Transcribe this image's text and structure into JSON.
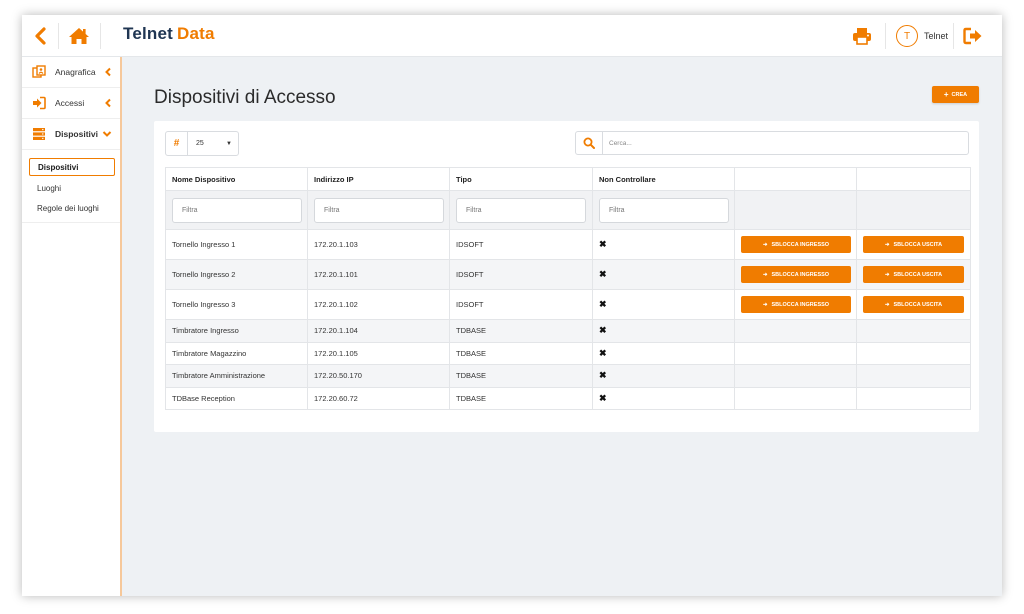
{
  "app": {
    "logo_part1": "Telnet",
    "logo_part2": "Data",
    "brand_color": "#f07c00",
    "logo_color": "#1f3552"
  },
  "topbar": {
    "user_initial": "T",
    "user_name": "Telnet"
  },
  "sidebar": {
    "items": [
      {
        "label": "Anagrafica",
        "icon": "address-card-icon"
      },
      {
        "label": "Accessi",
        "icon": "sign-in-icon"
      },
      {
        "label": "Dispositivi",
        "icon": "server-icon"
      }
    ],
    "subitems": [
      {
        "label": "Dispositivi"
      },
      {
        "label": "Luoghi"
      },
      {
        "label": "Regole dei luoghi"
      }
    ]
  },
  "page": {
    "title": "Dispositivi di Accesso",
    "create_label": "CREA"
  },
  "toolbar": {
    "page_size_symbol": "#",
    "page_size": "25",
    "search_placeholder": "Cerca..."
  },
  "table": {
    "columns": [
      "Nome Dispositivo",
      "Indirizzo IP",
      "Tipo",
      "Non Controllare"
    ],
    "filter_placeholder": "Filtra",
    "unlock_in_label": "SBLOCCA INGRESSO",
    "unlock_out_label": "SBLOCCA USCITA",
    "rows": [
      {
        "name": "Tornello Ingresso 1",
        "ip": "172.20.1.103",
        "type": "IDSOFT",
        "non_controllare": "✖"
      },
      {
        "name": "Tornello Ingresso 2",
        "ip": "172.20.1.101",
        "type": "IDSOFT",
        "non_controllare": "✖"
      },
      {
        "name": "Tornello Ingresso 3",
        "ip": "172.20.1.102",
        "type": "IDSOFT",
        "non_controllare": "✖"
      },
      {
        "name": "Timbratore Ingresso",
        "ip": "172.20.1.104",
        "type": "TDBASE",
        "non_controllare": "✖"
      },
      {
        "name": "Timbratore Magazzino",
        "ip": "172.20.1.105",
        "type": "TDBASE",
        "non_controllare": "✖"
      },
      {
        "name": "Timbratore Amministrazione",
        "ip": "172.20.50.170",
        "type": "TDBASE",
        "non_controllare": "✖"
      },
      {
        "name": "TDBase Reception",
        "ip": "172.20.60.72",
        "type": "TDBASE",
        "non_controllare": "✖"
      }
    ]
  }
}
